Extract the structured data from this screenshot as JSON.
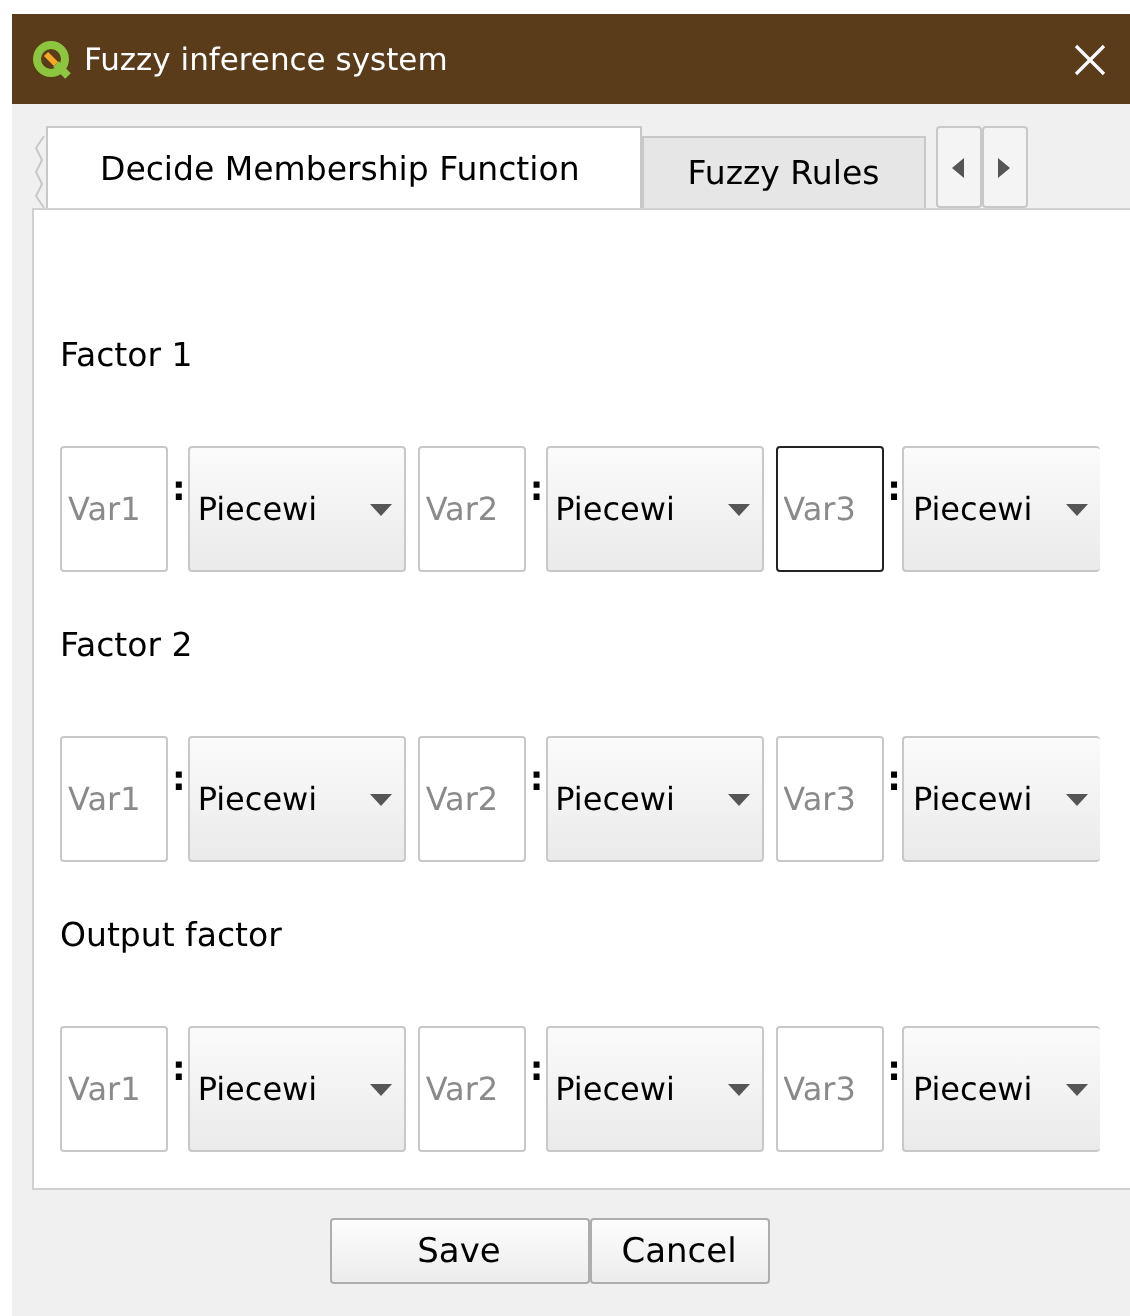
{
  "window": {
    "title": "Fuzzy inference system"
  },
  "tabs": [
    {
      "label": "Decide Membership Function",
      "selected": true
    },
    {
      "label": "Fuzzy Rules",
      "selected": false
    }
  ],
  "factors": [
    {
      "label": "Factor 1",
      "variables": [
        {
          "placeholder": "Var1",
          "focused": false,
          "separator": ":",
          "function": "Piecewi"
        },
        {
          "placeholder": "Var2",
          "focused": false,
          "separator": ":",
          "function": "Piecewi"
        },
        {
          "placeholder": "Var3",
          "focused": true,
          "separator": ":",
          "function": "Piecewi"
        }
      ]
    },
    {
      "label": "Factor 2",
      "variables": [
        {
          "placeholder": "Var1",
          "focused": false,
          "separator": ":",
          "function": "Piecewi"
        },
        {
          "placeholder": "Var2",
          "focused": false,
          "separator": ":",
          "function": "Piecewi"
        },
        {
          "placeholder": "Var3",
          "focused": false,
          "separator": ":",
          "function": "Piecewi"
        }
      ]
    },
    {
      "label": "Output factor",
      "variables": [
        {
          "placeholder": "Var1",
          "focused": false,
          "separator": ":",
          "function": "Piecewi"
        },
        {
          "placeholder": "Var2",
          "focused": false,
          "separator": ":",
          "function": "Piecewi"
        },
        {
          "placeholder": "Var3",
          "focused": false,
          "separator": ":",
          "function": "Piecewi"
        }
      ]
    }
  ],
  "buttons": [
    "Save",
    "Cancel"
  ]
}
